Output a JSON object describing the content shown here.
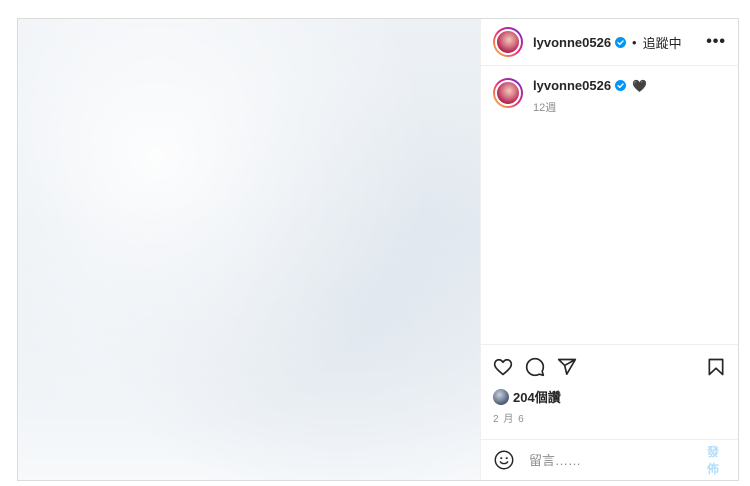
{
  "post": {
    "author": {
      "username": "lyvonne0526",
      "verified": true,
      "follow_status": "追蹤中",
      "separator": "•"
    },
    "more_label": "•••",
    "caption": {
      "username": "lyvonne0526",
      "text": "🖤",
      "time": "12週"
    },
    "likes": {
      "text": "204個讚"
    },
    "date": "2 月 6",
    "comment": {
      "placeholder": "留言……",
      "post_label": "發佈"
    },
    "icons": {
      "like": "heart-icon",
      "comment": "comment-icon",
      "share": "send-icon",
      "save": "bookmark-icon",
      "emoji": "emoji-icon",
      "more": "more-icon",
      "verified": "verified-badge-icon"
    },
    "colors": {
      "verified": "#0095f6",
      "post_button": "#b2dffc",
      "secondary_text": "#8e8e8e"
    }
  }
}
